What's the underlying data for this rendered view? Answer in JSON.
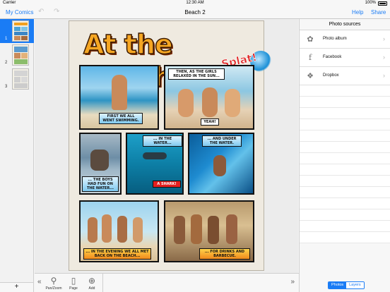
{
  "status_bar": {
    "carrier": "Carrier",
    "time": "12:30 AM",
    "battery": "100%"
  },
  "nav": {
    "back_label": "My Comics",
    "title": "Beach 2",
    "help_label": "Help",
    "share_label": "Share"
  },
  "pages": [
    {
      "number": "1",
      "selected": true
    },
    {
      "number": "2",
      "selected": false
    },
    {
      "number": "3",
      "selected": false
    }
  ],
  "add_page_label": "+",
  "comic": {
    "title": "At the Beach",
    "sticker": "Splat!",
    "captions": {
      "p1": "FIRST WE ALL WENT SWIMMING.",
      "p2_top": "THEN, AS THE GIRLS RELAXED IN THE SUN...",
      "p2_bottom": "YEAH!",
      "p3": "... THE BOYS HAD FUN ON THE WATER...",
      "p4_top": "... IN THE WATER...",
      "p4_bottom": "A SHARK!",
      "p5": "... AND UNDER THE WATER.",
      "p6": "... IN THE EVENING WE ALL MET BACK ON THE BEACH...",
      "p7": "... FOR DRINKS AND BARBECUE."
    }
  },
  "sources": {
    "header": "Photo sources",
    "items": [
      {
        "label": "Photo album",
        "icon": "flower-icon"
      },
      {
        "label": "Facebook",
        "icon": "facebook-icon"
      },
      {
        "label": "Dropbox",
        "icon": "dropbox-icon"
      }
    ],
    "tabs": [
      {
        "label": "Photos",
        "active": true
      },
      {
        "label": "Layers",
        "active": false
      }
    ]
  },
  "toolbar": {
    "tools": [
      {
        "label": "Pan/Zoom",
        "icon": "magnifier-icon"
      },
      {
        "label": "Page",
        "icon": "page-icon"
      },
      {
        "label": "Add",
        "icon": "plus-circle-icon"
      }
    ]
  },
  "colors": {
    "accent": "#1a7cf5"
  }
}
